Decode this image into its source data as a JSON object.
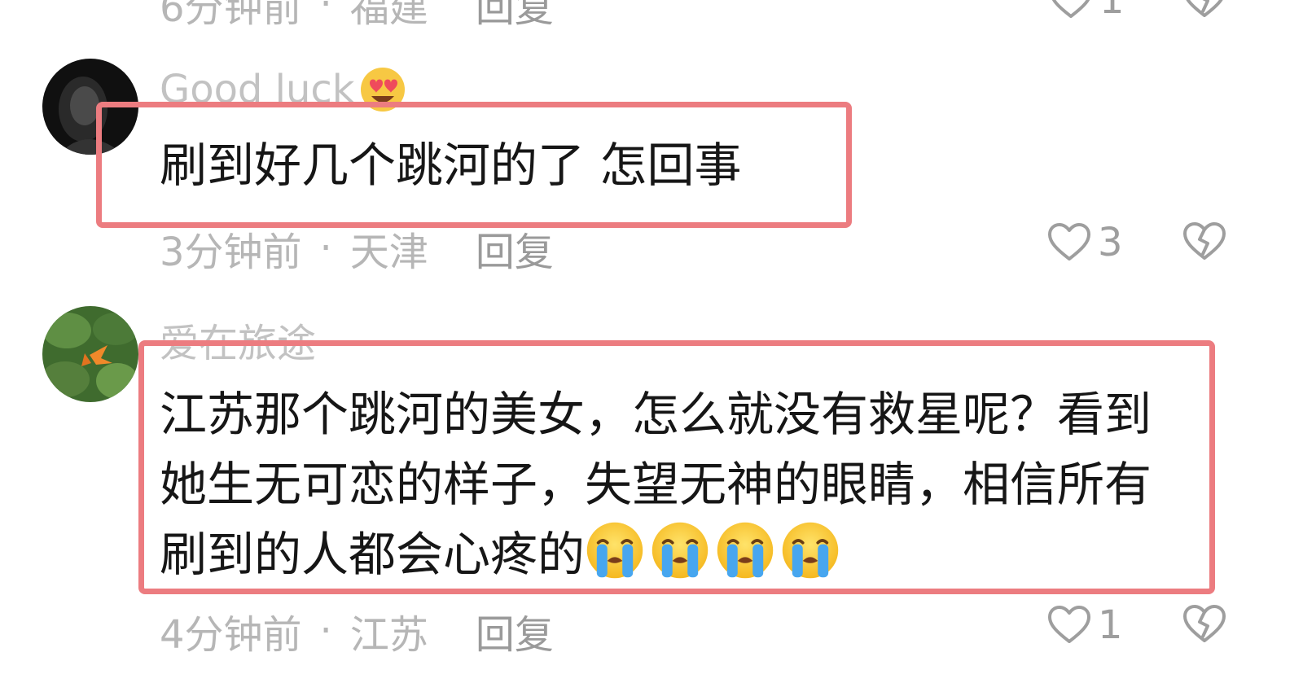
{
  "top_partial": {
    "time": "6分钟前",
    "separator": "·",
    "location": "福建",
    "reply_label": "回复",
    "like_count": "1"
  },
  "comments": [
    {
      "username": "Good luck",
      "username_emoji": "heart-eyes-emoji",
      "text": "刷到好几个跳河的了 怎回事",
      "time": "3分钟前",
      "separator": "·",
      "location": "天津",
      "reply_label": "回复",
      "like_count": "3"
    },
    {
      "username": "爱在旅途",
      "text_lines": [
        "江苏那个跳河的美女，怎么就没有救星呢？看到",
        "她生无可恋的样子，失望无神的眼睛，相信所有",
        "刷到的人都会心疼的"
      ],
      "trailing_emojis": [
        "crying-face-emoji",
        "crying-face-emoji",
        "crying-face-emoji",
        "crying-face-emoji"
      ],
      "time": "4分钟前",
      "separator": "·",
      "location": "江苏",
      "reply_label": "回复",
      "like_count": "1"
    }
  ],
  "colors": {
    "highlight_border": "#ec7c80",
    "meta_text": "#b6b6b6",
    "comment_text": "#161616"
  }
}
